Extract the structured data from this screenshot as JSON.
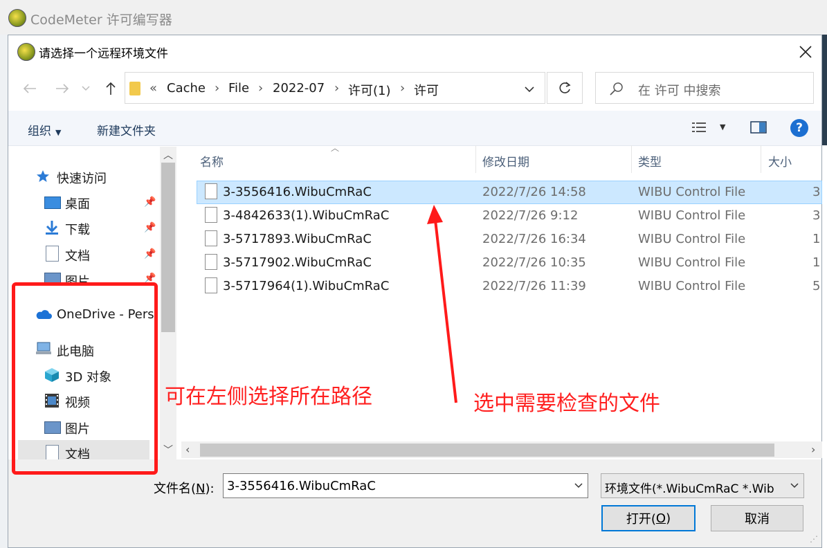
{
  "background_app": {
    "title": "CodeMeter 许可编写器"
  },
  "dialog": {
    "title": "请选择一个远程环境文件",
    "address": {
      "overflow": "«",
      "segments": [
        "Cache",
        "File",
        "2022-07",
        "许可(1)",
        "许可"
      ]
    },
    "search_placeholder": "在 许可 中搜索",
    "toolbar": {
      "organize": "组织",
      "new_folder": "新建文件夹",
      "help": "?"
    },
    "nav_pane": {
      "quick_access": "快速访问",
      "quick_items": [
        "桌面",
        "下载",
        "文档",
        "图片"
      ],
      "onedrive": "OneDrive - Pers",
      "this_pc": "此电脑",
      "pc_items": [
        "3D 对象",
        "视频",
        "图片",
        "文档"
      ]
    },
    "columns": {
      "name": "名称",
      "date": "修改日期",
      "type": "类型",
      "size": "大小"
    },
    "files": [
      {
        "name": "3-3556416.WibuCmRaC",
        "date": "2022/7/26 14:58",
        "type": "WIBU Control File",
        "size": "3",
        "selected": true
      },
      {
        "name": "3-4842633(1).WibuCmRaC",
        "date": "2022/7/26 9:12",
        "type": "WIBU Control File",
        "size": "3",
        "selected": false
      },
      {
        "name": "3-5717893.WibuCmRaC",
        "date": "2022/7/26 16:34",
        "type": "WIBU Control File",
        "size": "1",
        "selected": false
      },
      {
        "name": "3-5717902.WibuCmRaC",
        "date": "2022/7/26 10:35",
        "type": "WIBU Control File",
        "size": "1",
        "selected": false
      },
      {
        "name": "3-5717964(1).WibuCmRaC",
        "date": "2022/7/26 11:39",
        "type": "WIBU Control File",
        "size": "5",
        "selected": false
      }
    ],
    "filename_label_pre": "文件名(",
    "filename_label_key": "N",
    "filename_label_post": "):",
    "filename_value": "3-3556416.WibuCmRaC",
    "filetype_value": "环境文件(*.WibuCmRaC *.Wib",
    "open_pre": "打开(",
    "open_key": "O",
    "open_post": ")",
    "cancel": "取消"
  },
  "annotations": {
    "left": "可在左侧选择所在路径",
    "right": "选中需要检查的文件"
  },
  "colors": {
    "accent": "#0078d7",
    "selection": "#cce8ff",
    "annotation": "#ff1a1a"
  }
}
